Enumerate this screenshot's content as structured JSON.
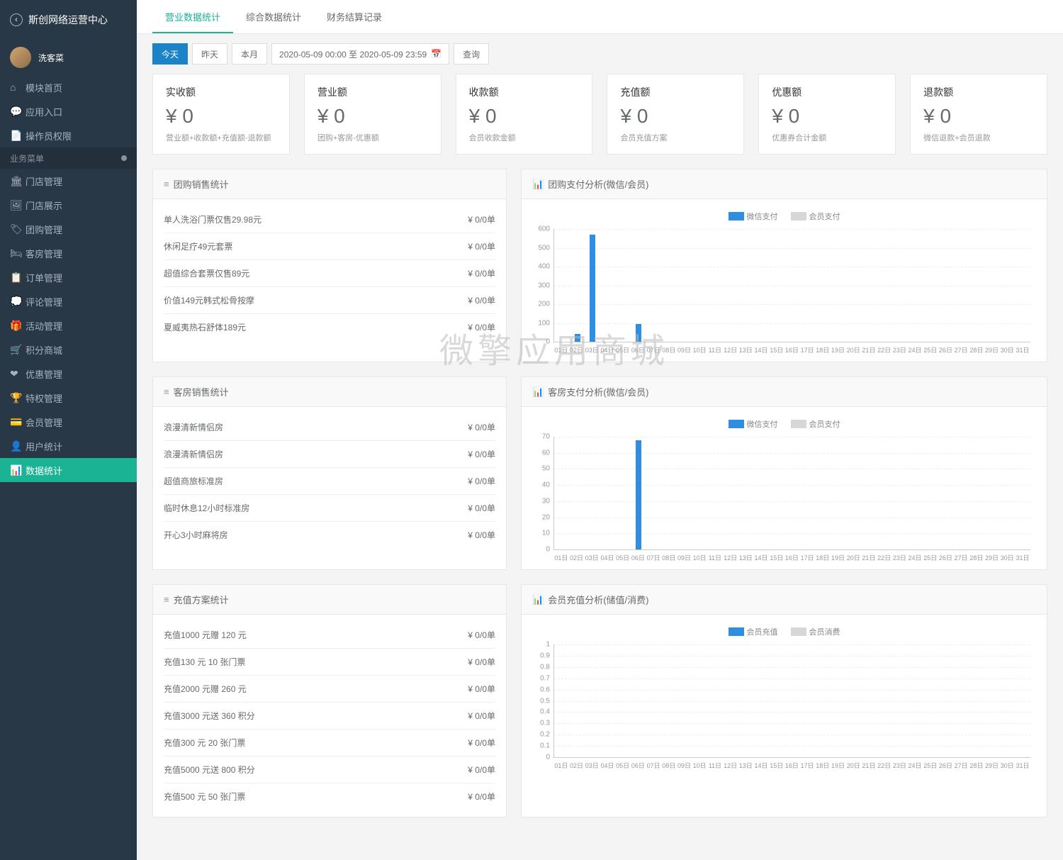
{
  "brand": "斯创网络运营中心",
  "user": "洗客菜",
  "sidebar": {
    "top": [
      {
        "icon": "⌂",
        "label": "模块首页"
      },
      {
        "icon": "💬",
        "label": "应用入口"
      },
      {
        "icon": "📄",
        "label": "操作员权限"
      }
    ],
    "section_header": "业务菜单",
    "biz": [
      {
        "icon": "🏛",
        "label": "门店管理"
      },
      {
        "icon": "🖼",
        "label": "门店展示"
      },
      {
        "icon": "🏷",
        "label": "团购管理"
      },
      {
        "icon": "🛏",
        "label": "客房管理"
      },
      {
        "icon": "📋",
        "label": "订单管理"
      },
      {
        "icon": "💭",
        "label": "评论管理"
      },
      {
        "icon": "🎁",
        "label": "活动管理"
      },
      {
        "icon": "🛒",
        "label": "积分商城"
      },
      {
        "icon": "❤",
        "label": "优惠管理"
      },
      {
        "icon": "🏆",
        "label": "特权管理"
      },
      {
        "icon": "💳",
        "label": "会员管理"
      },
      {
        "icon": "👤",
        "label": "用户统计"
      },
      {
        "icon": "📊",
        "label": "数据统计"
      }
    ],
    "active_index": 12
  },
  "tabs": [
    {
      "label": "营业数据统计",
      "active": true
    },
    {
      "label": "综合数据统计",
      "active": false
    },
    {
      "label": "财务结算记录",
      "active": false
    }
  ],
  "filter": {
    "today": "今天",
    "yesterday": "昨天",
    "month": "本月",
    "range": "2020-05-09 00:00 至 2020-05-09 23:59",
    "query": "查询"
  },
  "kpis": [
    {
      "label": "实收额",
      "value": "¥ 0",
      "sub": "营业额+收款额+充值额-退款额"
    },
    {
      "label": "营业额",
      "value": "¥ 0",
      "sub": "团购+客房-优惠额"
    },
    {
      "label": "收款额",
      "value": "¥ 0",
      "sub": "会员收款金额"
    },
    {
      "label": "充值额",
      "value": "¥ 0",
      "sub": "会员充值方案"
    },
    {
      "label": "优惠额",
      "value": "¥ 0",
      "sub": "优惠券合计金额"
    },
    {
      "label": "退款额",
      "value": "¥ 0",
      "sub": "微信退款+会员退款"
    }
  ],
  "sections": [
    {
      "list_title": "团购销售统计",
      "list": [
        {
          "name": "单人洗浴门票仅售29.98元",
          "val": "¥ 0/0单"
        },
        {
          "name": "休闲足疗49元套票",
          "val": "¥ 0/0单"
        },
        {
          "name": "超值综合套票仅售89元",
          "val": "¥ 0/0单"
        },
        {
          "name": "价值149元韩式松骨按摩",
          "val": "¥ 0/0单"
        },
        {
          "name": "夏威夷热石舒体189元",
          "val": "¥ 0/0单"
        }
      ],
      "chart_title": "团购支付分析(微信/会员)",
      "chart_id": "c1"
    },
    {
      "list_title": "客房销售统计",
      "list": [
        {
          "name": "浪漫清新情侣房",
          "val": "¥ 0/0单"
        },
        {
          "name": "浪漫清新情侣房",
          "val": "¥ 0/0单"
        },
        {
          "name": "超值商旅标准房",
          "val": "¥ 0/0单"
        },
        {
          "name": "临时休息12小时标准房",
          "val": "¥ 0/0单"
        },
        {
          "name": "开心3小时麻将房",
          "val": "¥ 0/0单"
        }
      ],
      "chart_title": "客房支付分析(微信/会员)",
      "chart_id": "c2"
    },
    {
      "list_title": "充值方案统计",
      "list": [
        {
          "name": "充值1000 元赠 120 元",
          "val": "¥ 0/0单"
        },
        {
          "name": "充值130 元 10 张门票",
          "val": "¥ 0/0单"
        },
        {
          "name": "充值2000 元赠 260 元",
          "val": "¥ 0/0单"
        },
        {
          "name": "充值3000 元送 360 积分",
          "val": "¥ 0/0单"
        },
        {
          "name": "充值300 元 20 张门票",
          "val": "¥ 0/0单"
        },
        {
          "name": "充值5000 元送 800 积分",
          "val": "¥ 0/0单"
        },
        {
          "name": "充值500 元 50 张门票",
          "val": "¥ 0/0单"
        }
      ],
      "chart_title": "会员充值分析(储值/消费)",
      "chart_id": "c3"
    }
  ],
  "legends": {
    "pay": [
      "微信支付",
      "会员支付"
    ],
    "member": [
      "会员充值",
      "会员消费"
    ]
  },
  "watermark": "微擎应用商城",
  "chart_data": [
    {
      "type": "bar",
      "title": "团购支付分析(微信/会员)",
      "categories": [
        "01日",
        "02日",
        "03日",
        "04日",
        "05日",
        "06日",
        "07日",
        "08日",
        "09日",
        "10日",
        "11日",
        "12日",
        "13日",
        "14日",
        "15日",
        "16日",
        "17日",
        "18日",
        "19日",
        "20日",
        "21日",
        "22日",
        "23日",
        "24日",
        "25日",
        "26日",
        "27日",
        "28日",
        "29日",
        "30日",
        "31日"
      ],
      "series": [
        {
          "name": "微信支付",
          "values": [
            0,
            40,
            570,
            0,
            0,
            95,
            0,
            0,
            0,
            0,
            0,
            0,
            0,
            0,
            0,
            0,
            0,
            0,
            0,
            0,
            0,
            0,
            0,
            0,
            0,
            0,
            0,
            0,
            0,
            0,
            0
          ]
        },
        {
          "name": "会员支付",
          "values": [
            0,
            0,
            0,
            0,
            0,
            0,
            0,
            0,
            0,
            0,
            0,
            0,
            0,
            0,
            0,
            0,
            0,
            0,
            0,
            0,
            0,
            0,
            0,
            0,
            0,
            0,
            0,
            0,
            0,
            0,
            0
          ]
        }
      ],
      "ylim": [
        0,
        600
      ],
      "yticks": [
        0,
        100,
        200,
        300,
        400,
        500,
        600
      ]
    },
    {
      "type": "bar",
      "title": "客房支付分析(微信/会员)",
      "categories": [
        "01日",
        "02日",
        "03日",
        "04日",
        "05日",
        "06日",
        "07日",
        "08日",
        "09日",
        "10日",
        "11日",
        "12日",
        "13日",
        "14日",
        "15日",
        "16日",
        "17日",
        "18日",
        "19日",
        "20日",
        "21日",
        "22日",
        "23日",
        "24日",
        "25日",
        "26日",
        "27日",
        "28日",
        "29日",
        "30日",
        "31日"
      ],
      "series": [
        {
          "name": "微信支付",
          "values": [
            0,
            0,
            0,
            0,
            0,
            68,
            0,
            0,
            0,
            0,
            0,
            0,
            0,
            0,
            0,
            0,
            0,
            0,
            0,
            0,
            0,
            0,
            0,
            0,
            0,
            0,
            0,
            0,
            0,
            0,
            0
          ]
        },
        {
          "name": "会员支付",
          "values": [
            0,
            0,
            0,
            0,
            0,
            0,
            0,
            0,
            0,
            0,
            0,
            0,
            0,
            0,
            0,
            0,
            0,
            0,
            0,
            0,
            0,
            0,
            0,
            0,
            0,
            0,
            0,
            0,
            0,
            0,
            0
          ]
        }
      ],
      "ylim": [
        0,
        70
      ],
      "yticks": [
        0,
        10,
        20,
        30,
        40,
        50,
        60,
        70
      ]
    },
    {
      "type": "bar",
      "title": "会员充值分析(储值/消费)",
      "categories": [
        "01日",
        "02日",
        "03日",
        "04日",
        "05日",
        "06日",
        "07日",
        "08日",
        "09日",
        "10日",
        "11日",
        "12日",
        "13日",
        "14日",
        "15日",
        "16日",
        "17日",
        "18日",
        "19日",
        "20日",
        "21日",
        "22日",
        "23日",
        "24日",
        "25日",
        "26日",
        "27日",
        "28日",
        "29日",
        "30日",
        "31日"
      ],
      "series": [
        {
          "name": "会员充值",
          "values": [
            0,
            0,
            0,
            0,
            0,
            0,
            0,
            0,
            0,
            0,
            0,
            0,
            0,
            0,
            0,
            0,
            0,
            0,
            0,
            0,
            0,
            0,
            0,
            0,
            0,
            0,
            0,
            0,
            0,
            0,
            0
          ]
        },
        {
          "name": "会员消费",
          "values": [
            0,
            0,
            0,
            0,
            0,
            0,
            0,
            0,
            0,
            0,
            0,
            0,
            0,
            0,
            0,
            0,
            0,
            0,
            0,
            0,
            0,
            0,
            0,
            0,
            0,
            0,
            0,
            0,
            0,
            0,
            0
          ]
        }
      ],
      "ylim": [
        0,
        1.0
      ],
      "yticks": [
        0,
        0.1,
        0.2,
        0.3,
        0.4,
        0.5,
        0.6,
        0.7,
        0.8,
        0.9,
        1.0
      ]
    }
  ]
}
